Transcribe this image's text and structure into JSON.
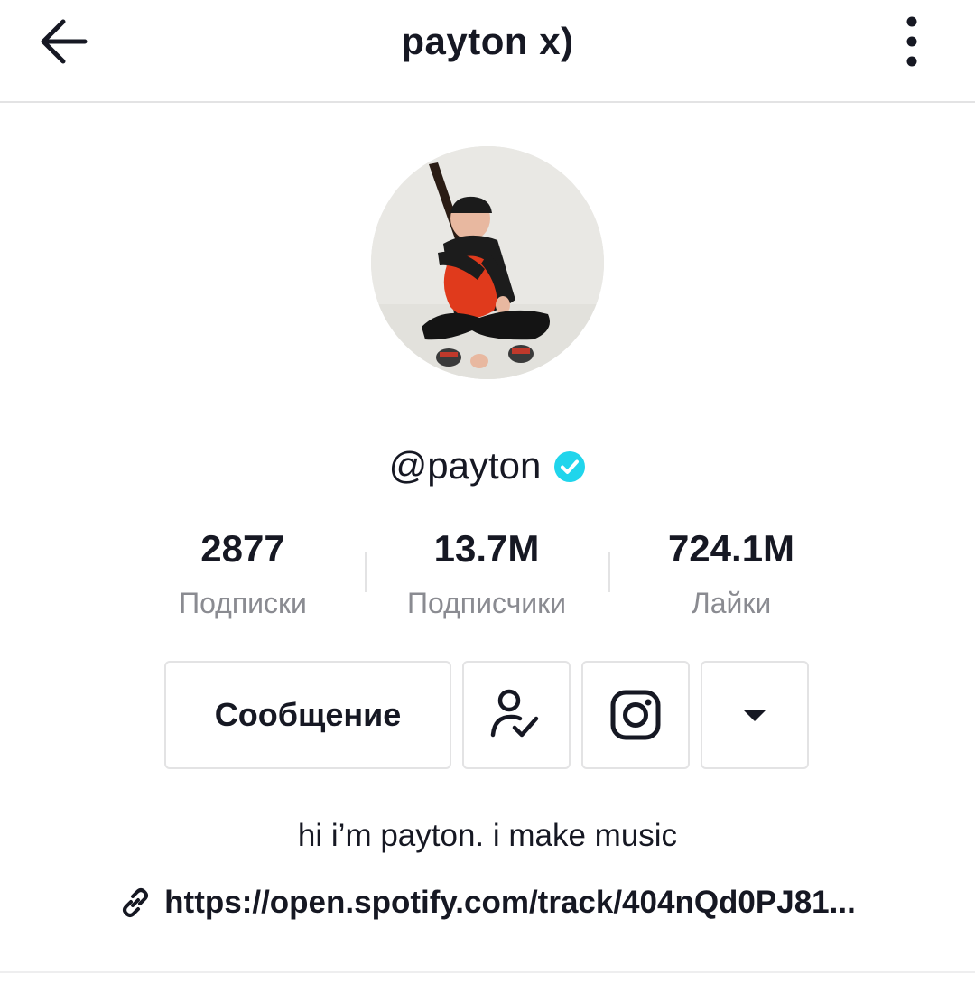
{
  "header": {
    "title": "payton x)",
    "back_icon": "arrow-left-icon",
    "more_icon": "vertical-dots-icon"
  },
  "profile": {
    "avatar_alt": "Profile photo",
    "username": "@payton",
    "verified_icon": "verified-check-icon",
    "verified_color": "#20d5ec"
  },
  "stats": [
    {
      "value": "2877",
      "label": "Подписки"
    },
    {
      "value": "13.7M",
      "label": "Подписчики"
    },
    {
      "value": "724.1M",
      "label": "Лайки"
    }
  ],
  "actions": {
    "message_label": "Сообщение",
    "following_icon": "person-check-icon",
    "instagram_icon": "instagram-icon",
    "dropdown_icon": "caret-down-icon"
  },
  "bio": {
    "text": "hi i’m payton. i make music",
    "link_icon": "link-icon",
    "link": "https://open.spotify.com/track/404nQd0PJ81..."
  }
}
